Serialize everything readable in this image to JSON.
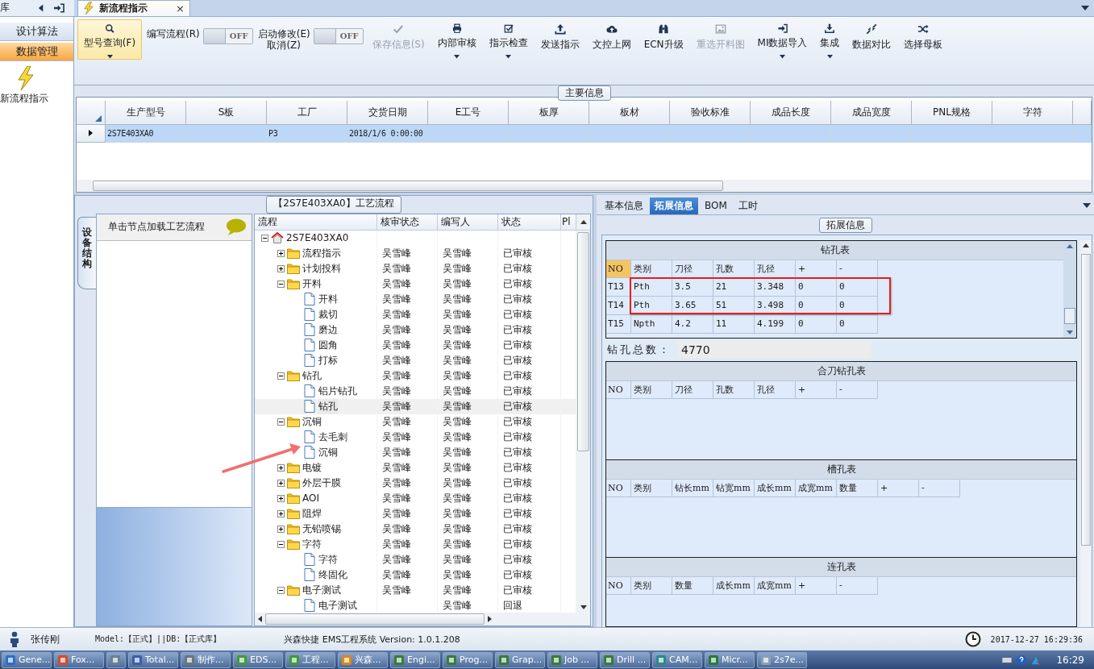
{
  "top_bar": {
    "module_label": "库",
    "tab": {
      "title": "新流程指示",
      "close": "×"
    }
  },
  "sidebar": {
    "items": [
      {
        "label": "设计算法",
        "selected": false
      },
      {
        "label": "数据管理",
        "selected": true
      }
    ],
    "shortcut": "新流程指示"
  },
  "ribbon": {
    "items": [
      {
        "kind": "button",
        "label": "型号查询(F)",
        "selected": true,
        "disabled": false,
        "dropdown": true
      },
      {
        "kind": "toggle",
        "lines": [
          "编写流程(R)"
        ],
        "value": "OFF",
        "on": false
      },
      {
        "kind": "toggle",
        "lines": [
          "启动修改(E)",
          "取消(Z)"
        ],
        "value": "OFF",
        "on": false
      },
      {
        "kind": "button",
        "label": "保存信息(S)",
        "selected": false,
        "disabled": true,
        "dropdown": false
      },
      {
        "kind": "button",
        "label": "内部审核",
        "selected": false,
        "disabled": false,
        "dropdown": true
      },
      {
        "kind": "button",
        "label": "指示检查",
        "selected": false,
        "disabled": false,
        "dropdown": true
      },
      {
        "kind": "button",
        "label": "发送指示",
        "selected": false,
        "disabled": false,
        "dropdown": false
      },
      {
        "kind": "button",
        "label": "文控上网",
        "selected": false,
        "disabled": false,
        "dropdown": false
      },
      {
        "kind": "button",
        "label": "ECN升级",
        "selected": false,
        "disabled": false,
        "dropdown": false
      },
      {
        "kind": "button",
        "label": "重选开料图",
        "selected": false,
        "disabled": true,
        "dropdown": false
      },
      {
        "kind": "button",
        "label": "MI数据导入",
        "selected": false,
        "disabled": false,
        "dropdown": true
      },
      {
        "kind": "button",
        "label": "集成",
        "selected": false,
        "disabled": false,
        "dropdown": true
      },
      {
        "kind": "button",
        "label": "数据对比",
        "selected": false,
        "disabled": false,
        "dropdown": false
      },
      {
        "kind": "button",
        "label": "选择母板",
        "selected": false,
        "disabled": false,
        "dropdown": false
      }
    ]
  },
  "main_info": {
    "title": "主要信息",
    "columns": [
      "生产型号",
      "S板",
      "工厂",
      "交货日期",
      "E工号",
      "板厚",
      "板材",
      "验收标准",
      "成品长度",
      "成品宽度",
      "PNL规格",
      "字符"
    ],
    "rows": [
      {
        "selected": true,
        "cells": [
          "2S7E403XA0",
          null,
          "P3",
          "2018/1/6 0:00:00"
        ]
      }
    ]
  },
  "process": {
    "title": "【2S7E403XA0】工艺流程",
    "side_tab": "设备结构",
    "hint": "单击节点加载工艺流程",
    "columns": [
      "流程",
      "核审状态",
      "编写人",
      "状态",
      "Pl"
    ],
    "tree": [
      {
        "kind": "root",
        "label": "2S7E403XA0",
        "expanded": true,
        "selected": false,
        "children": [
          {
            "kind": "folder",
            "label": "流程指示",
            "reviewer": "吴雪峰",
            "writer": "吴雪峰",
            "status": "已审核",
            "expanded": false,
            "selected": false
          },
          {
            "kind": "folder",
            "label": "计划投料",
            "reviewer": "吴雪峰",
            "writer": "吴雪峰",
            "status": "已审核",
            "expanded": false,
            "selected": false
          },
          {
            "kind": "folder",
            "label": "开料",
            "reviewer": "吴雪峰",
            "writer": "吴雪峰",
            "status": "已审核",
            "expanded": true,
            "selected": false,
            "children": [
              {
                "kind": "leaf",
                "label": "开料",
                "reviewer": "吴雪峰",
                "writer": "吴雪峰",
                "status": "已审核",
                "selected": false
              },
              {
                "kind": "leaf",
                "label": "裁切",
                "reviewer": "吴雪峰",
                "writer": "吴雪峰",
                "status": "已审核",
                "selected": false
              },
              {
                "kind": "leaf",
                "label": "磨边",
                "reviewer": "吴雪峰",
                "writer": "吴雪峰",
                "status": "已审核",
                "selected": false
              },
              {
                "kind": "leaf",
                "label": "圆角",
                "reviewer": "吴雪峰",
                "writer": "吴雪峰",
                "status": "已审核",
                "selected": false
              },
              {
                "kind": "leaf",
                "label": "打标",
                "reviewer": "吴雪峰",
                "writer": "吴雪峰",
                "status": "已审核",
                "selected": false
              }
            ]
          },
          {
            "kind": "folder",
            "label": "钻孔",
            "reviewer": "吴雪峰",
            "writer": "吴雪峰",
            "status": "已审核",
            "expanded": true,
            "selected": false,
            "children": [
              {
                "kind": "leaf",
                "label": "铝片钻孔",
                "reviewer": "吴雪峰",
                "writer": "吴雪峰",
                "status": "已审核",
                "selected": false
              },
              {
                "kind": "leaf",
                "label": "钻孔",
                "reviewer": "吴雪峰",
                "writer": "吴雪峰",
                "status": "已审核",
                "selected": true
              }
            ]
          },
          {
            "kind": "folder",
            "label": "沉铜",
            "reviewer": "吴雪峰",
            "writer": "吴雪峰",
            "status": "已审核",
            "expanded": true,
            "selected": false,
            "children": [
              {
                "kind": "leaf",
                "label": "去毛刺",
                "reviewer": "吴雪峰",
                "writer": "吴雪峰",
                "status": "已审核",
                "selected": false
              },
              {
                "kind": "leaf",
                "label": "沉铜",
                "reviewer": "吴雪峰",
                "writer": "吴雪峰",
                "status": "已审核",
                "selected": false
              }
            ]
          },
          {
            "kind": "folder",
            "label": "电镀",
            "reviewer": "吴雪峰",
            "writer": "吴雪峰",
            "status": "已审核",
            "expanded": false,
            "selected": false
          },
          {
            "kind": "folder",
            "label": "外层干膜",
            "reviewer": "吴雪峰",
            "writer": "吴雪峰",
            "status": "已审核",
            "expanded": false,
            "selected": false
          },
          {
            "kind": "folder",
            "label": "AOI",
            "reviewer": "吴雪峰",
            "writer": "吴雪峰",
            "status": "已审核",
            "expanded": false,
            "selected": false
          },
          {
            "kind": "folder",
            "label": "阻焊",
            "reviewer": "吴雪峰",
            "writer": "吴雪峰",
            "status": "已审核",
            "expanded": false,
            "selected": false
          },
          {
            "kind": "folder",
            "label": "无铅喷锡",
            "reviewer": "吴雪峰",
            "writer": "吴雪峰",
            "status": "已审核",
            "expanded": false,
            "selected": false
          },
          {
            "kind": "folder",
            "label": "字符",
            "reviewer": "吴雪峰",
            "writer": "吴雪峰",
            "status": "已审核",
            "expanded": true,
            "selected": false,
            "children": [
              {
                "kind": "leaf",
                "label": "字符",
                "reviewer": "吴雪峰",
                "writer": "吴雪峰",
                "status": "已审核",
                "selected": false
              },
              {
                "kind": "leaf",
                "label": "终固化",
                "reviewer": "吴雪峰",
                "writer": "吴雪峰",
                "status": "已审核",
                "selected": false
              }
            ]
          },
          {
            "kind": "folder",
            "label": "电子测试",
            "reviewer": "吴雪峰",
            "writer": "吴雪峰",
            "status": "已审核",
            "expanded": true,
            "selected": false,
            "children": [
              {
                "kind": "leaf",
                "label": "电子测试",
                "writer": "吴雪峰",
                "status": "回退",
                "selected": false
              }
            ]
          }
        ]
      }
    ]
  },
  "details": {
    "tabs": [
      {
        "label": "基本信息",
        "selected": false
      },
      {
        "label": "拓展信息",
        "selected": true
      },
      {
        "label": "BOM",
        "selected": false
      },
      {
        "label": "工时",
        "selected": false
      }
    ],
    "group_title": "拓展信息",
    "drill_table": {
      "title": "钻孔表",
      "columns": [
        {
          "label": "NO",
          "selected": true
        },
        {
          "label": "类别",
          "selected": false
        },
        {
          "label": "刀径",
          "selected": false
        },
        {
          "label": "孔数",
          "selected": false
        },
        {
          "label": "孔径",
          "selected": false
        },
        {
          "label": "+",
          "selected": false
        },
        {
          "label": "-",
          "selected": false
        }
      ],
      "rows": [
        [
          "T13",
          "Pth",
          "3.5",
          "21",
          "3.348",
          "0",
          "0"
        ],
        [
          "T14",
          "Pth",
          "3.65",
          "51",
          "3.498",
          "0",
          "0"
        ],
        [
          "T15",
          "Npth",
          "4.2",
          "11",
          "4.199",
          "0",
          "0"
        ]
      ]
    },
    "drill_total": {
      "label": "钻孔总数：",
      "value": "4770"
    },
    "tables": [
      {
        "title": "合刀钻孔表",
        "columns": [
          "NO",
          "类别",
          "刀径",
          "孔数",
          "孔径",
          "+",
          "-"
        ]
      },
      {
        "title": "槽孔表",
        "columns": [
          "NO",
          "类别",
          "钻长mm",
          "钻宽mm",
          "成长mm",
          "成宽mm",
          "数量",
          "+",
          "-"
        ]
      },
      {
        "title": "连孔表",
        "columns": [
          "NO",
          "类别",
          "数量",
          "成长mm",
          "成宽mm",
          "+",
          "-"
        ]
      }
    ]
  },
  "status_bar": {
    "user": "张传刚",
    "model": "Model:【正式】||DB:【正式库】",
    "app": "兴森快捷 EMS工程系统 Version: 1.0.1.208",
    "datetime": "2017-12-27 16:29:36"
  },
  "taskbar": {
    "items": [
      {
        "kind": "app",
        "label": "Gene..."
      },
      {
        "kind": "app",
        "label": "Fox..."
      },
      {
        "kind": "icon"
      },
      {
        "kind": "app",
        "label": "Total..."
      },
      {
        "kind": "app",
        "label": "制作..."
      },
      {
        "kind": "app",
        "label": "EDS..."
      },
      {
        "kind": "app",
        "label": "工程..."
      },
      {
        "kind": "app",
        "label": "兴森..."
      },
      {
        "kind": "app",
        "label": "Engi..."
      },
      {
        "kind": "app",
        "label": "Prog..."
      },
      {
        "kind": "app",
        "label": "Grap..."
      },
      {
        "kind": "app",
        "label": "Job ..."
      },
      {
        "kind": "app",
        "label": "Drill ..."
      },
      {
        "kind": "app",
        "label": "CAM..."
      },
      {
        "kind": "app",
        "label": "Micr..."
      },
      {
        "kind": "app",
        "label": "2s7e..."
      }
    ],
    "clock": "16:29"
  }
}
